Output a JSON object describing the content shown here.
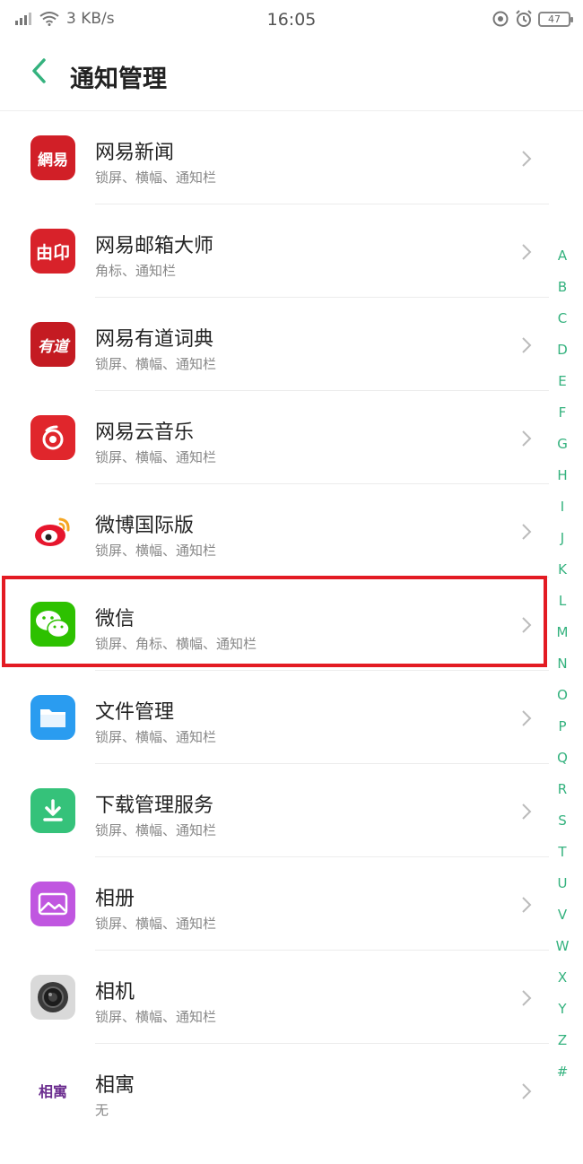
{
  "status_bar": {
    "network_speed": "3 KB/s",
    "time": "16:05",
    "battery": "47"
  },
  "header": {
    "title": "通知管理"
  },
  "apps": [
    {
      "name": "网易新闻",
      "sub": "锁屏、横幅、通知栏",
      "icon": "netease-news-icon",
      "color": "#d11f27",
      "glyph": "網易"
    },
    {
      "name": "网易邮箱大师",
      "sub": "角标、通知栏",
      "icon": "netease-mail-icon",
      "color": "#d8222a",
      "glyph": "由卬"
    },
    {
      "name": "网易有道词典",
      "sub": "锁屏、横幅、通知栏",
      "icon": "youdao-dict-icon",
      "color": "#c41b22",
      "glyph": "有道"
    },
    {
      "name": "网易云音乐",
      "sub": "锁屏、横幅、通知栏",
      "icon": "netease-music-icon",
      "color": "#e0262c",
      "glyph": ""
    },
    {
      "name": "微博国际版",
      "sub": "锁屏、横幅、通知栏",
      "icon": "weibo-icon",
      "color": "#ffffff",
      "glyph": ""
    },
    {
      "name": "微信",
      "sub": "锁屏、角标、横幅、通知栏",
      "icon": "wechat-icon",
      "color": "#2dc100",
      "glyph": ""
    },
    {
      "name": "文件管理",
      "sub": "锁屏、横幅、通知栏",
      "icon": "file-manager-icon",
      "color": "#2a9cf0",
      "glyph": ""
    },
    {
      "name": "下载管理服务",
      "sub": "锁屏、横幅、通知栏",
      "icon": "download-manager-icon",
      "color": "#35c27a",
      "glyph": ""
    },
    {
      "name": "相册",
      "sub": "锁屏、横幅、通知栏",
      "icon": "gallery-icon",
      "color": "#c056e0",
      "glyph": ""
    },
    {
      "name": "相机",
      "sub": "锁屏、横幅、通知栏",
      "icon": "camera-icon",
      "color": "#d9d9d9",
      "glyph": ""
    },
    {
      "name": "相寓",
      "sub": "无",
      "icon": "xiangyu-icon",
      "color": "#ffffff",
      "glyph": "相寓"
    }
  ],
  "alpha_index": [
    "A",
    "B",
    "C",
    "D",
    "E",
    "F",
    "G",
    "H",
    "I",
    "J",
    "K",
    "L",
    "M",
    "N",
    "O",
    "P",
    "Q",
    "R",
    "S",
    "T",
    "U",
    "V",
    "W",
    "X",
    "Y",
    "Z",
    "#"
  ],
  "colors": {
    "accent": "#34b27e",
    "highlight": "#e31b23"
  }
}
